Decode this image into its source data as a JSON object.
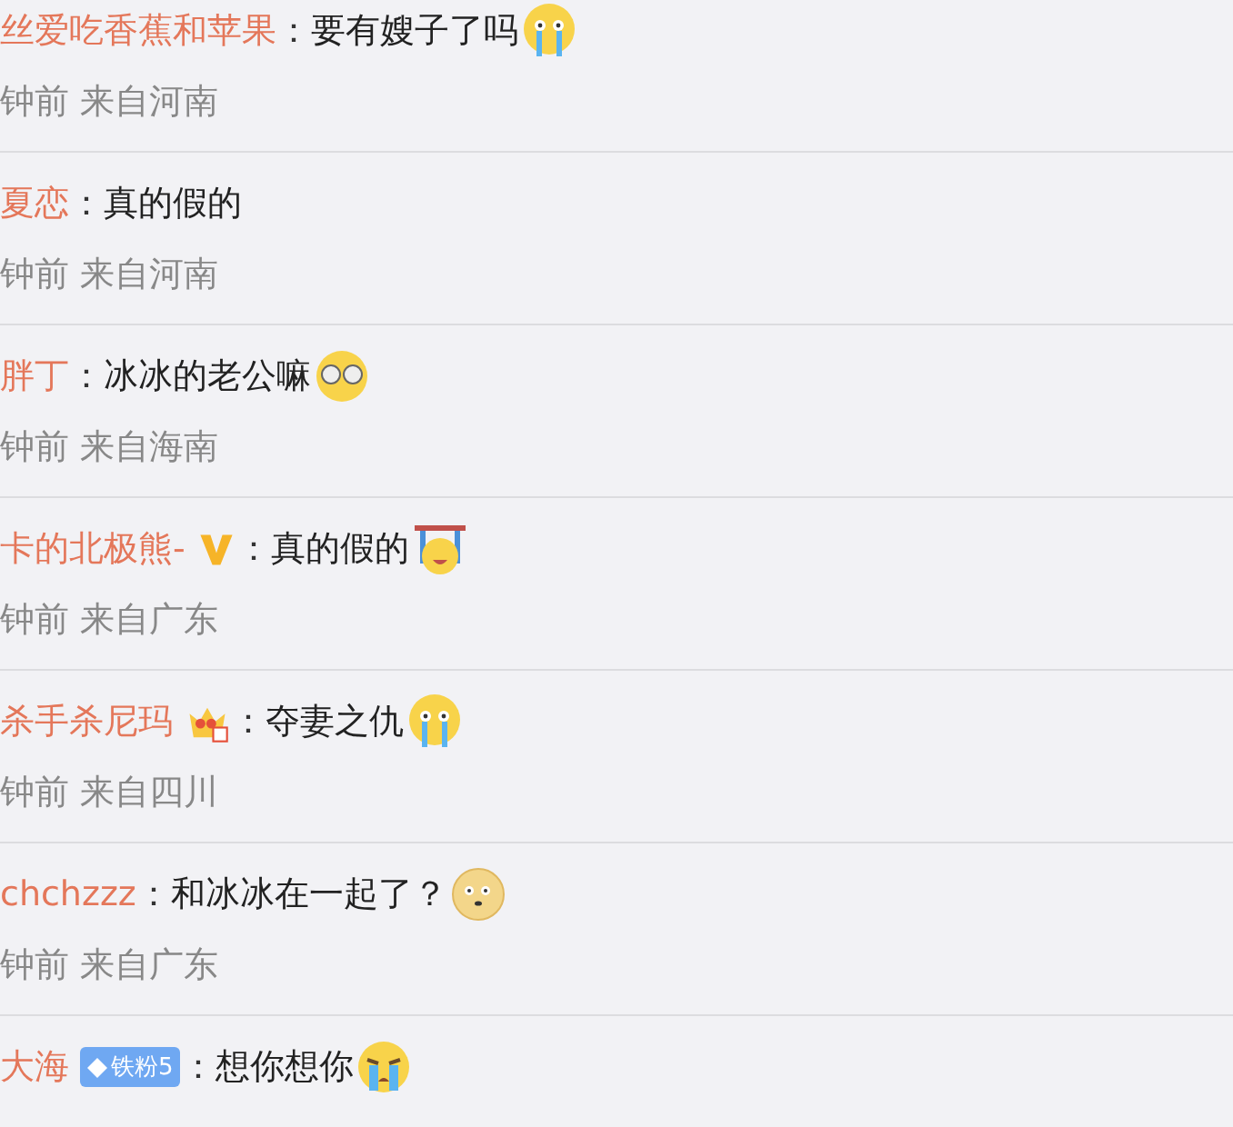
{
  "comments": [
    {
      "name": "丝爱吃香蕉和苹果",
      "colon": "：",
      "text": "要有嫂子了吗",
      "emoji": {
        "kind": "crying"
      },
      "meta": "钟前 来自河南"
    },
    {
      "name": "夏恋",
      "colon": "：",
      "text": "真的假的",
      "meta": "钟前 来自河南"
    },
    {
      "name": "胖丁",
      "colon": "：",
      "text": "冰冰的老公嘛",
      "emoji": {
        "kind": "glasses"
      },
      "meta": "钟前 来自海南"
    },
    {
      "name": "卡的北极熊-",
      "badge": {
        "kind": "vip"
      },
      "colon": "：",
      "text": "真的假的",
      "emoji": {
        "kind": "lifting"
      },
      "meta": "钟前 来自广东"
    },
    {
      "name": "杀手杀尼玛",
      "badge": {
        "kind": "crown"
      },
      "colon": "：",
      "text": "夺妻之仇",
      "emoji": {
        "kind": "crying"
      },
      "meta": "钟前 来自四川"
    },
    {
      "name": "chchzzz",
      "colon": "：",
      "text": "和冰冰在一起了？",
      "emoji": {
        "kind": "doge"
      },
      "meta": "钟前 来自广东"
    },
    {
      "name": "大海",
      "badge": {
        "kind": "fan",
        "text": "铁粉5"
      },
      "colon": "：",
      "text": "想你想你",
      "emoji": {
        "kind": "wailing"
      }
    }
  ]
}
